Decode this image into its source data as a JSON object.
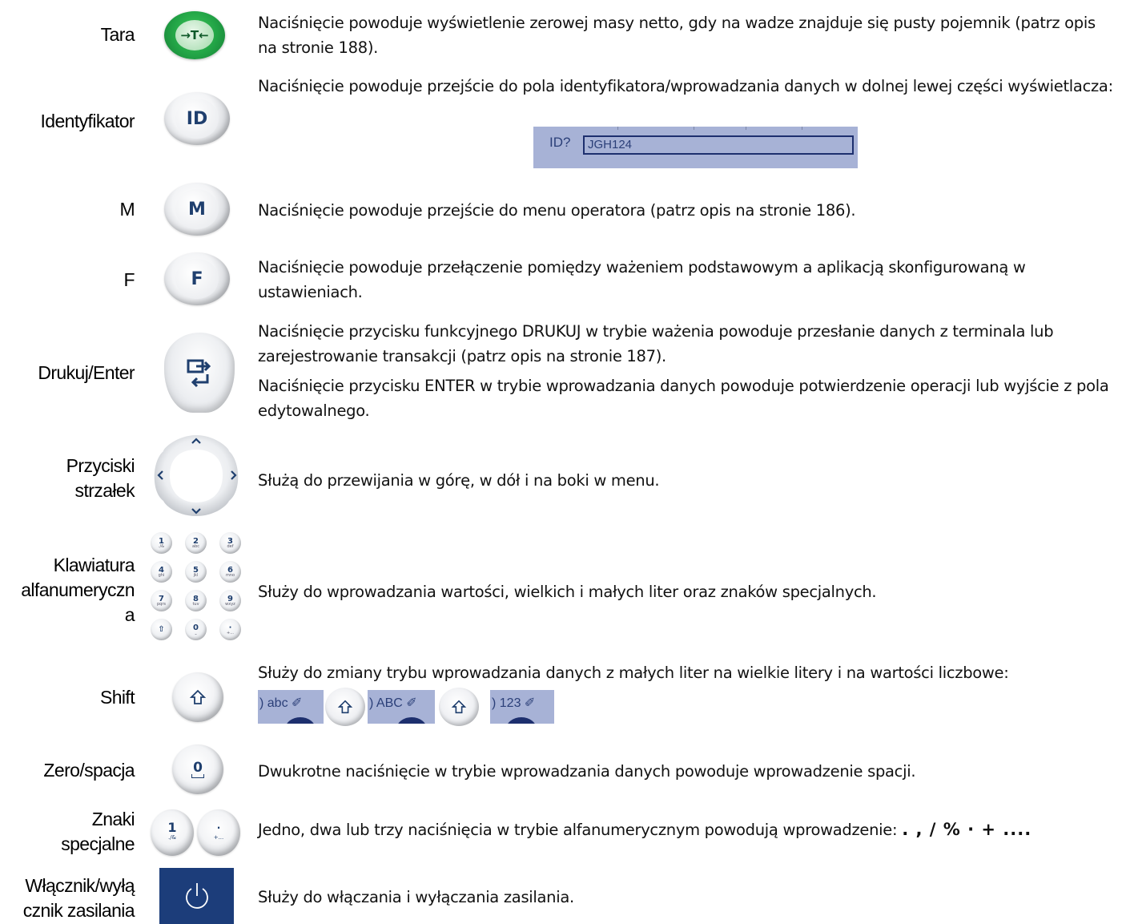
{
  "rows": {
    "tara": {
      "label": "Tara",
      "text": "Naciśnięcie powoduje wyświetlenie zerowej masy netto, gdy na wadze znajduje się pusty pojemnik (patrz opis na stronie 188).",
      "key": "→T←"
    },
    "id": {
      "label": "Identyfikator",
      "text": "Naciśnięcie powoduje przejście do pola identyfikatora/wprowadzania danych w dolnej lewej części wyświetlacza:",
      "key": "ID",
      "screen_label": "ID?",
      "screen_value": "JGH124"
    },
    "m": {
      "label": "M",
      "text": "Naciśnięcie powoduje przejście do menu operatora (patrz opis na stronie 186).",
      "key": "M"
    },
    "f": {
      "label": "F",
      "text": "Naciśnięcie powoduje przełączenie pomiędzy ważeniem podstawowym a aplikacją skonfigurowaną w ustawieniach.",
      "key": "F"
    },
    "drukuj": {
      "label": "Drukuj/Enter",
      "text1": "Naciśnięcie przycisku funkcyjnego DRUKUJ w trybie ważenia powoduje przesłanie danych z terminala lub zarejestrowanie transakcji (patrz opis na stronie 187).",
      "text2": "Naciśnięcie przycisku ENTER w trybie wprowadzania danych powoduje potwierdzenie operacji lub wyjście z pola edytowalnego."
    },
    "arrows": {
      "label_line1": "Przyciski",
      "label_line2": "strzałek",
      "text": "Służą do przewijania w górę, w dół i na boki w menu."
    },
    "keypad": {
      "label_line1": "Klawiatura",
      "label_line2": "alfanumeryczn",
      "label_line3": "a",
      "text": "Służy do wprowadzania wartości, wielkich i małych liter oraz znaków specjalnych.",
      "keys": [
        {
          "main": "1",
          "sub": "./&"
        },
        {
          "main": "2",
          "sub": "abc"
        },
        {
          "main": "3",
          "sub": "def"
        },
        {
          "main": "4",
          "sub": "ghi"
        },
        {
          "main": "5",
          "sub": "jkl"
        },
        {
          "main": "6",
          "sub": "mno"
        },
        {
          "main": "7",
          "sub": "pqrs"
        },
        {
          "main": "8",
          "sub": "tuv"
        },
        {
          "main": "9",
          "sub": "wxyz"
        },
        {
          "main": "⇧",
          "sub": ""
        },
        {
          "main": "0",
          "sub": "⎵"
        },
        {
          "main": "·",
          "sub": "+..."
        }
      ]
    },
    "shift": {
      "label": "Shift",
      "text": "Służy do zmiany trybu wprowadzania danych z małych liter na wielkie litery i na wartości liczbowe:",
      "modes": [
        "abc",
        "ABC",
        "123"
      ]
    },
    "zero": {
      "label": "Zero/spacja",
      "text": "Dwukrotne naciśnięcie w trybie wprowadzania danych powoduje wprowadzenie spacji."
    },
    "special": {
      "label_line1": "Znaki",
      "label_line2": "specjalne",
      "text": "Jedno, dwa lub trzy naciśnięcia w trybie alfanumerycznym powodują wprowadzenie:",
      "chars": ". , / % · + ...."
    },
    "power": {
      "label_line1": "Włącznik/wyłą",
      "label_line2": "cznik zasilania",
      "text": "Służy do włączania i wyłączania zasilania."
    }
  }
}
